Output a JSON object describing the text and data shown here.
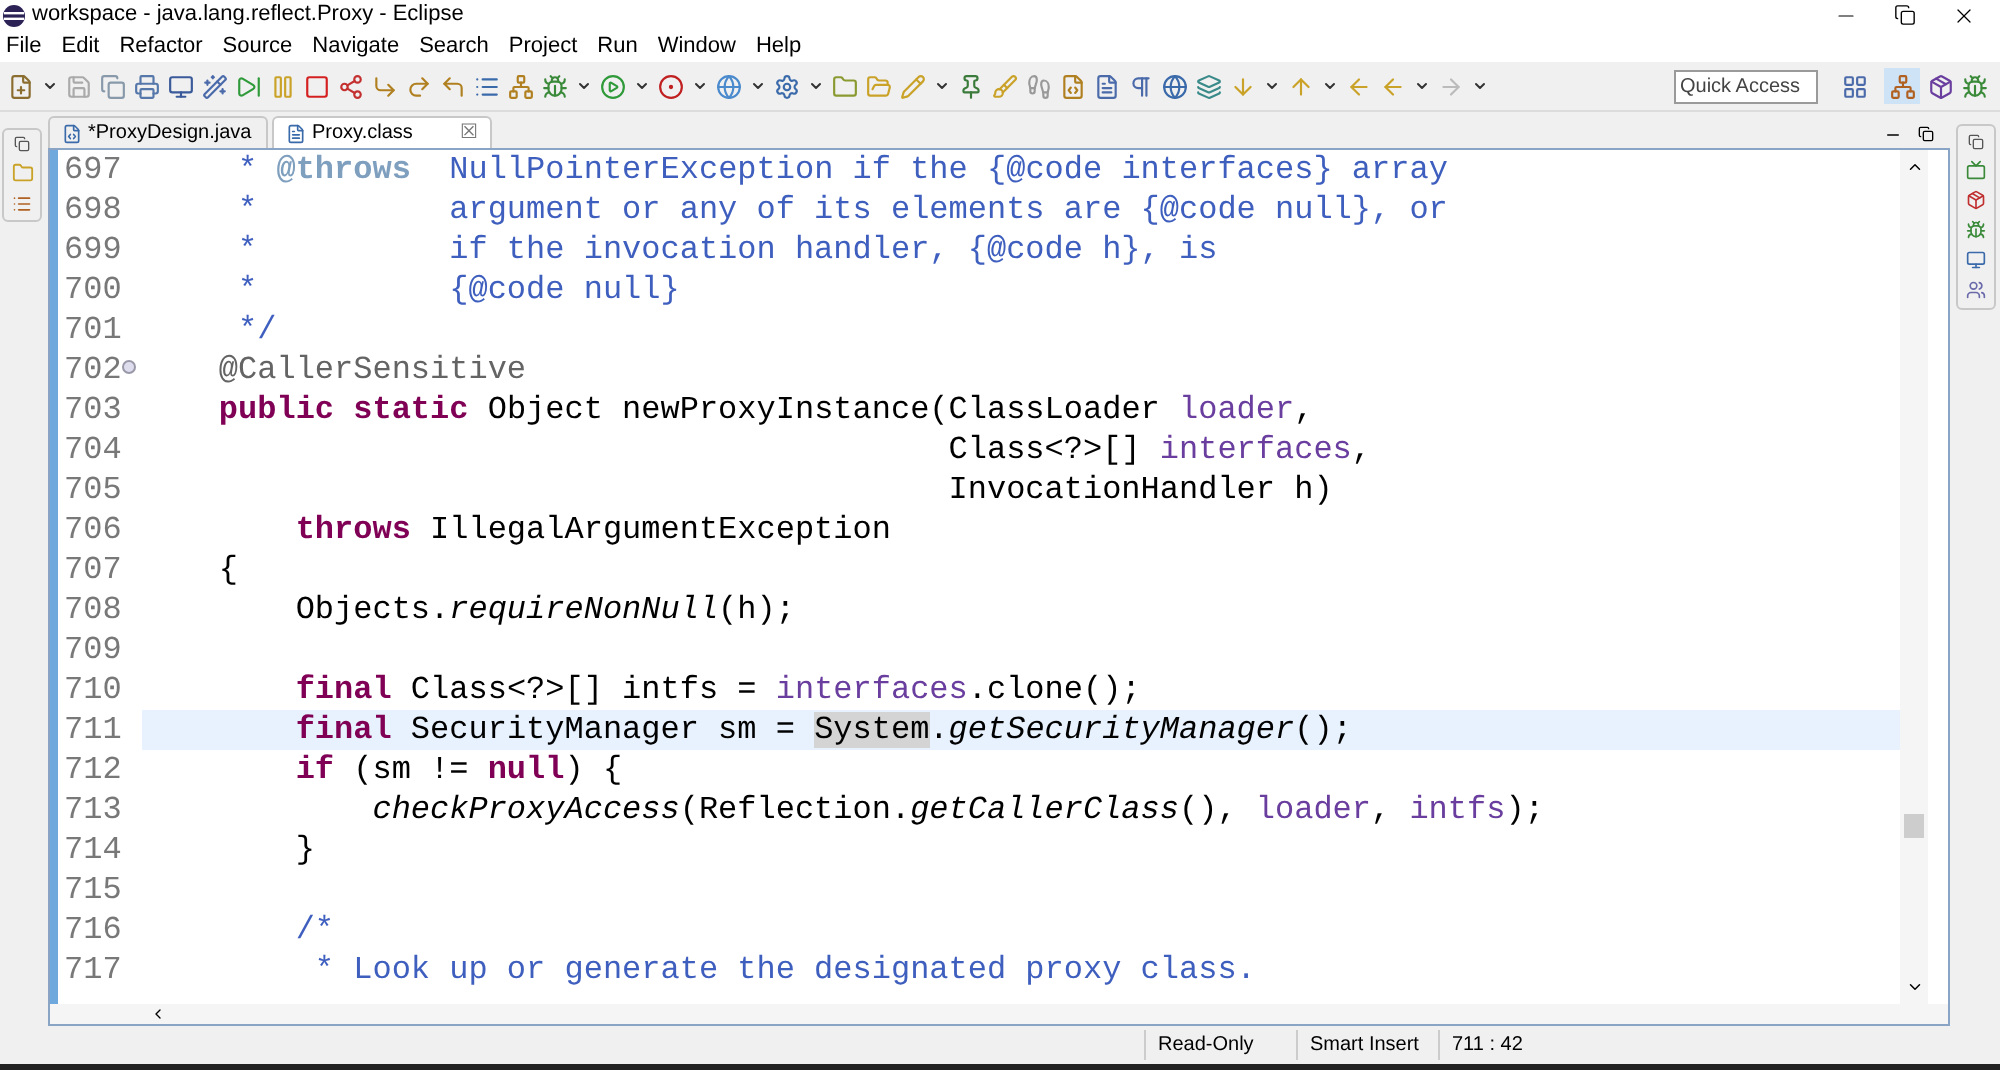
{
  "window": {
    "title": "workspace - java.lang.reflect.Proxy - Eclipse"
  },
  "menu": [
    "File",
    "Edit",
    "Refactor",
    "Source",
    "Navigate",
    "Search",
    "Project",
    "Run",
    "Window",
    "Help"
  ],
  "quick_access": {
    "placeholder": "Quick Access"
  },
  "tabs": [
    {
      "label": "*ProxyDesign.java",
      "selected": false,
      "kind": "java"
    },
    {
      "label": "Proxy.class",
      "selected": true,
      "kind": "class",
      "close": "☒"
    }
  ],
  "editor": {
    "lines": [
      {
        "number": "697",
        "current": false,
        "folding": false,
        "tokens": [
          {
            "kind": "doc",
            "text": "     * "
          },
          {
            "kind": "doctag",
            "text": "@throws"
          },
          {
            "kind": "doc",
            "text": "  NullPointerException if the {@code interfaces} array"
          }
        ]
      },
      {
        "number": "698",
        "current": false,
        "folding": false,
        "tokens": [
          {
            "kind": "doc",
            "text": "     *          argument or any of its elements are {@code null}, or"
          }
        ]
      },
      {
        "number": "699",
        "current": false,
        "folding": false,
        "tokens": [
          {
            "kind": "doc",
            "text": "     *          if the invocation handler, {@code h}, is"
          }
        ]
      },
      {
        "number": "700",
        "current": false,
        "folding": false,
        "tokens": [
          {
            "kind": "doc",
            "text": "     *          {@code null}"
          }
        ]
      },
      {
        "number": "701",
        "current": false,
        "folding": false,
        "tokens": [
          {
            "kind": "doc",
            "text": "     */"
          }
        ]
      },
      {
        "number": "702",
        "current": false,
        "folding": true,
        "tokens": [
          {
            "kind": "annotation",
            "text": "    @CallerSensitive"
          }
        ]
      },
      {
        "number": "703",
        "current": false,
        "folding": false,
        "tokens": [
          {
            "kind": "keyword",
            "text": "    public static"
          },
          {
            "kind": "plain",
            "text": " Object newProxyInstance(ClassLoader "
          },
          {
            "kind": "var",
            "text": "loader"
          },
          {
            "kind": "plain",
            "text": ","
          }
        ]
      },
      {
        "number": "704",
        "current": false,
        "folding": false,
        "tokens": [
          {
            "kind": "plain",
            "text": "                                          Class<?>[] "
          },
          {
            "kind": "var",
            "text": "interfaces"
          },
          {
            "kind": "plain",
            "text": ","
          }
        ]
      },
      {
        "number": "705",
        "current": false,
        "folding": false,
        "tokens": [
          {
            "kind": "plain",
            "text": "                                          InvocationHandler h)"
          }
        ]
      },
      {
        "number": "706",
        "current": false,
        "folding": false,
        "tokens": [
          {
            "kind": "keyword",
            "text": "        throws"
          },
          {
            "kind": "plain",
            "text": " IllegalArgumentException"
          }
        ]
      },
      {
        "number": "707",
        "current": false,
        "folding": false,
        "tokens": [
          {
            "kind": "plain",
            "text": "    {"
          }
        ]
      },
      {
        "number": "708",
        "current": false,
        "folding": false,
        "tokens": [
          {
            "kind": "plain",
            "text": "        Objects."
          },
          {
            "kind": "static",
            "text": "requireNonNull"
          },
          {
            "kind": "plain",
            "text": "(h);"
          }
        ]
      },
      {
        "number": "709",
        "current": false,
        "folding": false
      },
      {
        "number": "710",
        "current": false,
        "folding": false,
        "tokens": [
          {
            "kind": "keyword",
            "text": "        final"
          },
          {
            "kind": "plain",
            "text": " Class<?>[] intfs = "
          },
          {
            "kind": "var",
            "text": "interfaces"
          },
          {
            "kind": "plain",
            "text": ".clone();"
          }
        ]
      },
      {
        "number": "711",
        "current": true,
        "folding": false,
        "tokens": [
          {
            "kind": "keyword",
            "text": "        final"
          },
          {
            "kind": "plain",
            "text": " SecurityManager sm = "
          },
          {
            "kind": "occurrence",
            "text": "System"
          },
          {
            "kind": "plain",
            "text": "."
          },
          {
            "kind": "static",
            "text": "getSecurityManager"
          },
          {
            "kind": "plain",
            "text": "();"
          }
        ]
      },
      {
        "number": "712",
        "current": false,
        "folding": false,
        "tokens": [
          {
            "kind": "keyword",
            "text": "        if"
          },
          {
            "kind": "plain",
            "text": " (sm != "
          },
          {
            "kind": "keyword",
            "text": "null"
          },
          {
            "kind": "plain",
            "text": ") {"
          }
        ]
      },
      {
        "number": "713",
        "current": false,
        "folding": false,
        "tokens": [
          {
            "kind": "static",
            "text": "            checkProxyAccess"
          },
          {
            "kind": "plain",
            "text": "(Reflection."
          },
          {
            "kind": "static",
            "text": "getCallerClass"
          },
          {
            "kind": "plain",
            "text": "(), "
          },
          {
            "kind": "var",
            "text": "loader"
          },
          {
            "kind": "plain",
            "text": ", "
          },
          {
            "kind": "var",
            "text": "intfs"
          },
          {
            "kind": "plain",
            "text": ");"
          }
        ]
      },
      {
        "number": "714",
        "current": false,
        "folding": false,
        "tokens": [
          {
            "kind": "plain",
            "text": "        }"
          }
        ]
      },
      {
        "number": "715",
        "current": false,
        "folding": false
      },
      {
        "number": "716",
        "current": false,
        "folding": false,
        "tokens": [
          {
            "kind": "doc",
            "text": "        /*"
          }
        ]
      },
      {
        "number": "717",
        "current": false,
        "folding": false,
        "tokens": [
          {
            "kind": "doc",
            "text": "         * Look up or generate the designated proxy class."
          }
        ]
      }
    ]
  },
  "status_bar": {
    "mode": "Read-Only",
    "insert": "Smart Insert",
    "position": "711 : 42"
  }
}
